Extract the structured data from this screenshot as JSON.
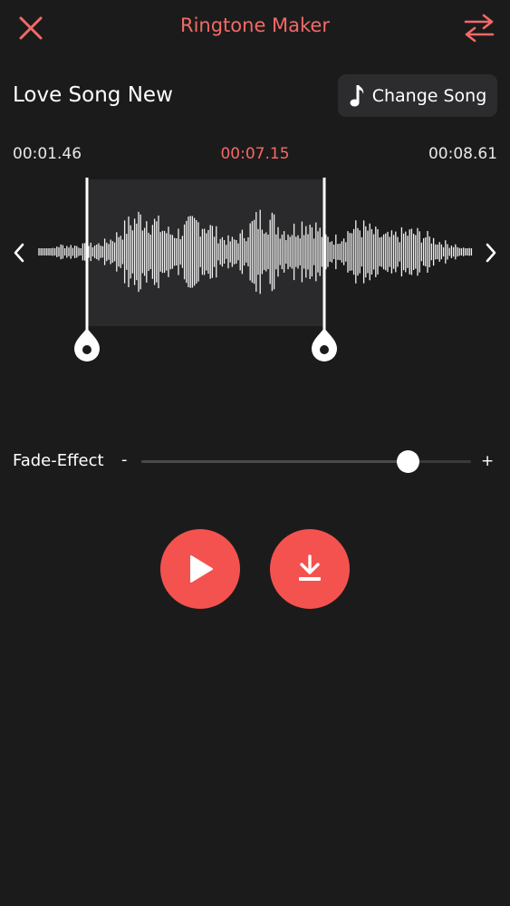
{
  "header": {
    "title": "Ringtone Maker",
    "close_icon": "close-icon",
    "swap_icon": "swap-arrows-icon",
    "accent_color": "#f26a66"
  },
  "song": {
    "title": "Love Song New",
    "change_button_label": "Change Song",
    "change_button_icon": "music-note-icon"
  },
  "times": {
    "start": "00:01.46",
    "current": "00:07.15",
    "end": "00:08.61"
  },
  "waveform": {
    "selection_start_fraction": 0.17,
    "selection_end_fraction": 0.635,
    "left_icon": "chevron-left-icon",
    "right_icon": "chevron-right-icon"
  },
  "fade": {
    "label": "Fade-Effect",
    "minus": "-",
    "plus": "+",
    "level_fraction": 0.81
  },
  "controls": {
    "play_icon": "play-icon",
    "download_icon": "download-icon",
    "button_color": "#f4524f"
  }
}
